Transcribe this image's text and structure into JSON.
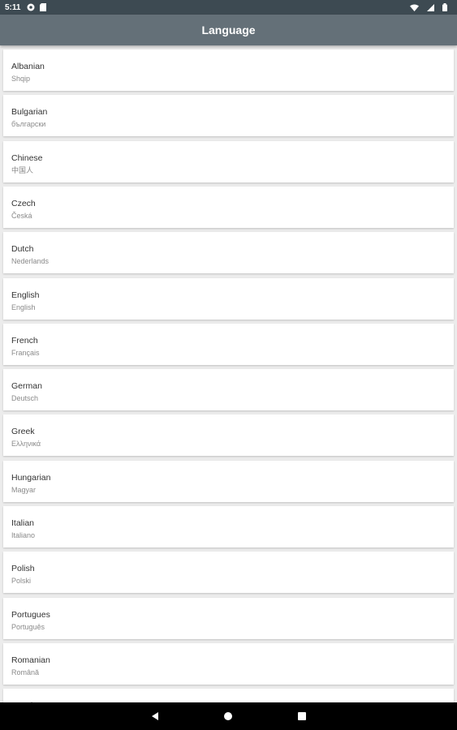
{
  "status_bar": {
    "time": "5:11",
    "icons_left": [
      "settings-icon",
      "sd-card-icon"
    ],
    "icons_right": [
      "wifi-icon",
      "signal-icon",
      "battery-icon"
    ]
  },
  "app_bar": {
    "title": "Language",
    "color": "#647078"
  },
  "languages": [
    {
      "name": "Albanian",
      "native": "Shqip"
    },
    {
      "name": "Bulgarian",
      "native": "български"
    },
    {
      "name": "Chinese",
      "native": "中国人"
    },
    {
      "name": "Czech",
      "native": "Česká"
    },
    {
      "name": "Dutch",
      "native": "Nederlands"
    },
    {
      "name": "English",
      "native": "English"
    },
    {
      "name": "French",
      "native": "Français"
    },
    {
      "name": "German",
      "native": "Deutsch"
    },
    {
      "name": "Greek",
      "native": "Ελληνικά"
    },
    {
      "name": "Hungarian",
      "native": "Magyar"
    },
    {
      "name": "Italian",
      "native": "Italiano"
    },
    {
      "name": "Polish",
      "native": "Polski"
    },
    {
      "name": "Portugues",
      "native": "Português"
    },
    {
      "name": "Romanian",
      "native": "Română"
    },
    {
      "name": "Russian",
      "native": ""
    }
  ],
  "nav_bar": {
    "buttons": [
      "back-icon",
      "home-icon",
      "recents-icon"
    ]
  }
}
